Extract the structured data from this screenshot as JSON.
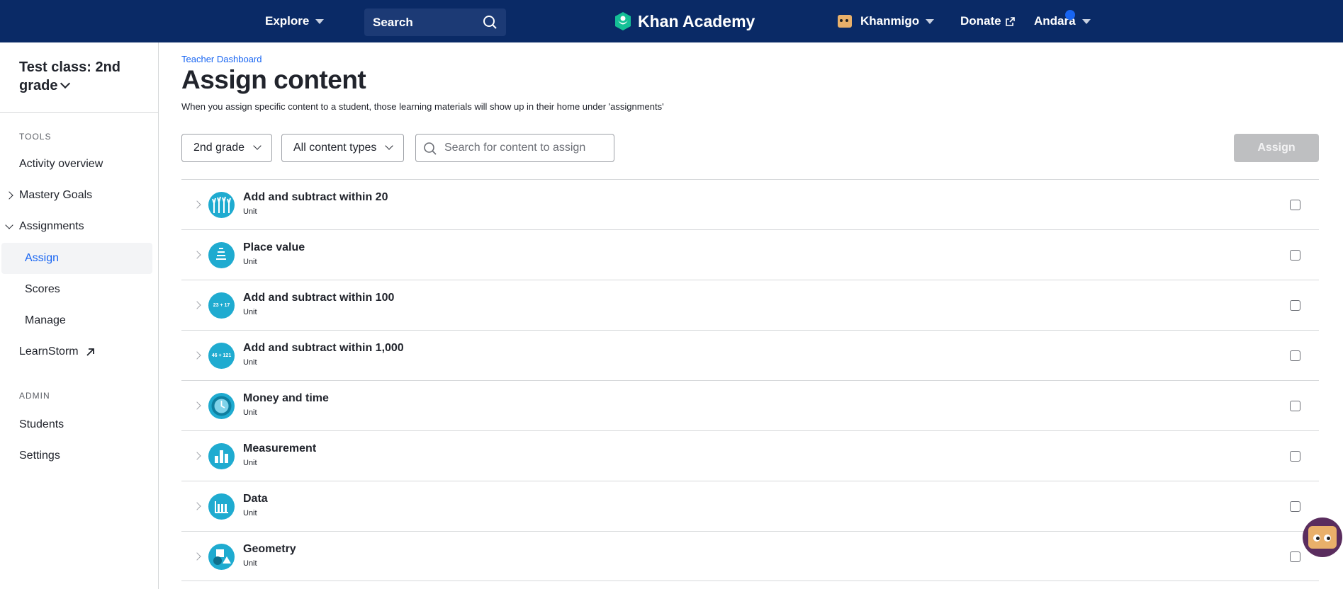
{
  "topnav": {
    "explore_label": "Explore",
    "search_label": "Search",
    "logo_text": "Khan Academy",
    "khanmigo_label": "Khanmigo",
    "donate_label": "Donate",
    "user_label": "Andara",
    "bg_color": "#0a2a66"
  },
  "sidebar": {
    "class_title": "Test class: 2nd grade",
    "tools_label": "TOOLS",
    "admin_label": "ADMIN",
    "items": {
      "activity_overview": "Activity overview",
      "mastery_goals": "Mastery Goals",
      "assignments": "Assignments",
      "assign": "Assign",
      "scores": "Scores",
      "manage": "Manage",
      "learnstorm": "LearnStorm",
      "students": "Students",
      "settings": "Settings"
    }
  },
  "main": {
    "breadcrumb": "Teacher Dashboard",
    "title": "Assign content",
    "description": "When you assign specific content to a student, those learning materials will show up in their home under 'assignments'",
    "grade_filter": "2nd grade",
    "content_type_filter": "All content types",
    "search_placeholder": "Search for content to assign",
    "assign_button": "Assign",
    "units": [
      {
        "title": "Add and subtract within 20",
        "type": "Unit",
        "icon": "hands-icon"
      },
      {
        "title": "Place value",
        "type": "Unit",
        "icon": "place-value-icon"
      },
      {
        "title": "Add and subtract within 100",
        "type": "Unit",
        "icon": "sum-icon",
        "icon_text": "23 + 17"
      },
      {
        "title": "Add and subtract within 1,000",
        "type": "Unit",
        "icon": "sum-icon",
        "icon_text": "46 + 121"
      },
      {
        "title": "Money and time",
        "type": "Unit",
        "icon": "clock-icon"
      },
      {
        "title": "Measurement",
        "type": "Unit",
        "icon": "bars-icon"
      },
      {
        "title": "Data",
        "type": "Unit",
        "icon": "data-icon"
      },
      {
        "title": "Geometry",
        "type": "Unit",
        "icon": "shapes-icon"
      }
    ]
  },
  "colors": {
    "accent": "#1865f2",
    "icon_bg": "#1fabd0",
    "disabled_button": "#bebfc1"
  }
}
